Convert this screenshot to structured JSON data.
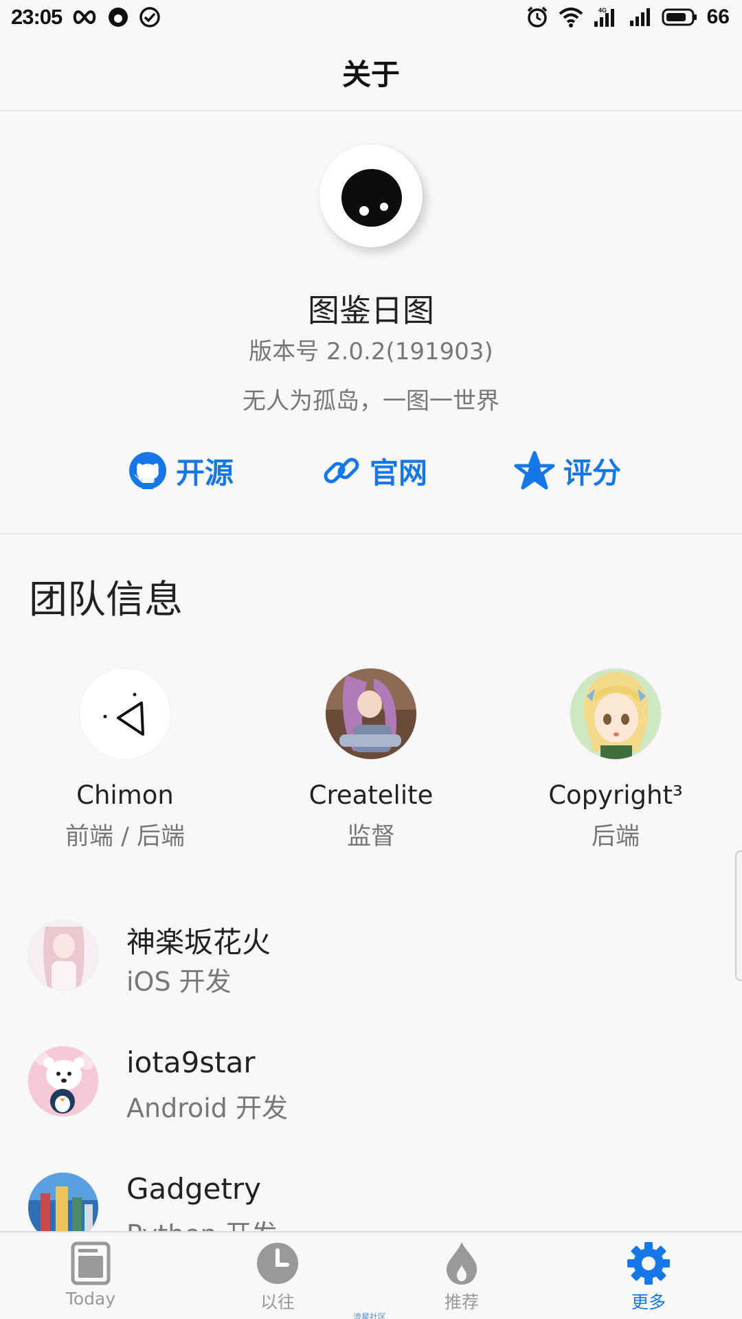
{
  "status_bar": {
    "time": "23:05",
    "battery": "66",
    "left_icons": [
      "infinity-icon",
      "face-icon",
      "check-circle-icon"
    ],
    "right_icons": [
      "alarm-icon",
      "wifi-icon",
      "signal-4g-icon",
      "signal-icon",
      "battery-icon"
    ]
  },
  "header": {
    "title": "关于"
  },
  "app": {
    "name": "图鉴日图",
    "version": "版本号 2.0.2(191903)",
    "slogan": "无人为孤岛，一图一世界"
  },
  "actions": [
    {
      "label": "开源",
      "icon": "github-icon"
    },
    {
      "label": "官网",
      "icon": "link-icon"
    },
    {
      "label": "评分",
      "icon": "star-icon"
    }
  ],
  "team": {
    "title": "团队信息",
    "cards": [
      {
        "name": "Chimon",
        "role": "前端 / 后端"
      },
      {
        "name": "Createlite",
        "role": "监督"
      },
      {
        "name": "Copyright³",
        "role": "后端"
      }
    ],
    "members": [
      {
        "name": "神楽坂花火",
        "role": "iOS 开发"
      },
      {
        "name": "iota9star",
        "role": "Android 开发"
      },
      {
        "name": "Gadgetry",
        "role": "Python 开发"
      }
    ]
  },
  "bottom_nav": {
    "items": [
      {
        "label": "Today",
        "icon": "today-icon",
        "active": false
      },
      {
        "label": "以往",
        "icon": "clock-icon",
        "active": false
      },
      {
        "label": "推荐",
        "icon": "flame-icon",
        "active": false
      },
      {
        "label": "更多",
        "icon": "gear-icon",
        "active": true
      }
    ],
    "watermark": "流星社区"
  },
  "colors": {
    "accent": "#1677e6",
    "text": "#222222",
    "muted": "#777777",
    "background": "#f8f8f8"
  }
}
